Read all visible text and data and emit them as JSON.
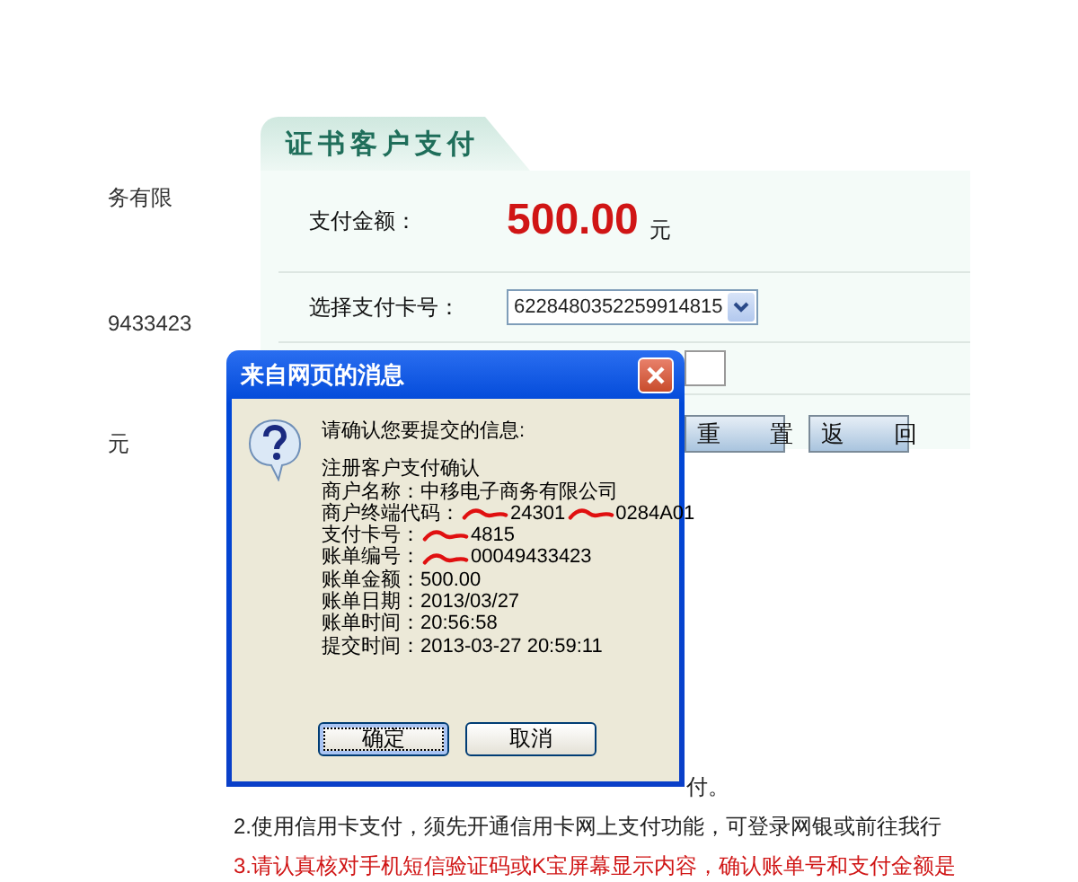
{
  "left_labels": [
    "务有限",
    "9433423",
    "元"
  ],
  "panel": {
    "title": "证书客户支付",
    "amount_label": "支付金额：",
    "amount": "500.00",
    "currency": "元",
    "card_label": "选择支付卡号：",
    "card_value": "6228480352259914815",
    "buttons": [
      "重 置",
      "返 回"
    ]
  },
  "dialog": {
    "title": "来自网页的消息",
    "prompt": "请确认您要提交的信息:",
    "lines": [
      {
        "parts": [
          "注册客户支付确认"
        ],
        "redacted": false
      },
      {
        "parts": [
          "商户名称：中移电子商务有限公司"
        ],
        "redacted": false
      },
      {
        "parts": [
          "商户终端代码：",
          "24301",
          "0284A01"
        ],
        "redacted": true
      },
      {
        "parts": [
          "支付卡号：",
          "4815"
        ],
        "redacted": true
      },
      {
        "parts": [
          "账单编号：",
          "00049433423"
        ],
        "redacted": true
      },
      {
        "parts": [
          "账单金额：500.00"
        ],
        "redacted": false
      },
      {
        "parts": [
          "账单日期：2013/03/27"
        ],
        "redacted": false
      },
      {
        "parts": [
          "账单时间：20:56:58"
        ],
        "redacted": false
      },
      {
        "parts": [
          "提交时间：2013-03-27 20:59:11"
        ],
        "redacted": false
      }
    ],
    "buttons": [
      {
        "label": "确定",
        "focused": true
      },
      {
        "label": "取消",
        "focused": false
      }
    ]
  },
  "notes": [
    {
      "text": "付。",
      "kind": "covered"
    },
    {
      "text": "2.使用信用卡支付，须先开通信用卡网上支付功能，可登录网银或前往我行",
      "kind": "normal"
    },
    {
      "text": "3.请认真核对手机短信验证码或K宝屏幕显示内容，确认账单号和支付金额是",
      "kind": "warning"
    }
  ]
}
